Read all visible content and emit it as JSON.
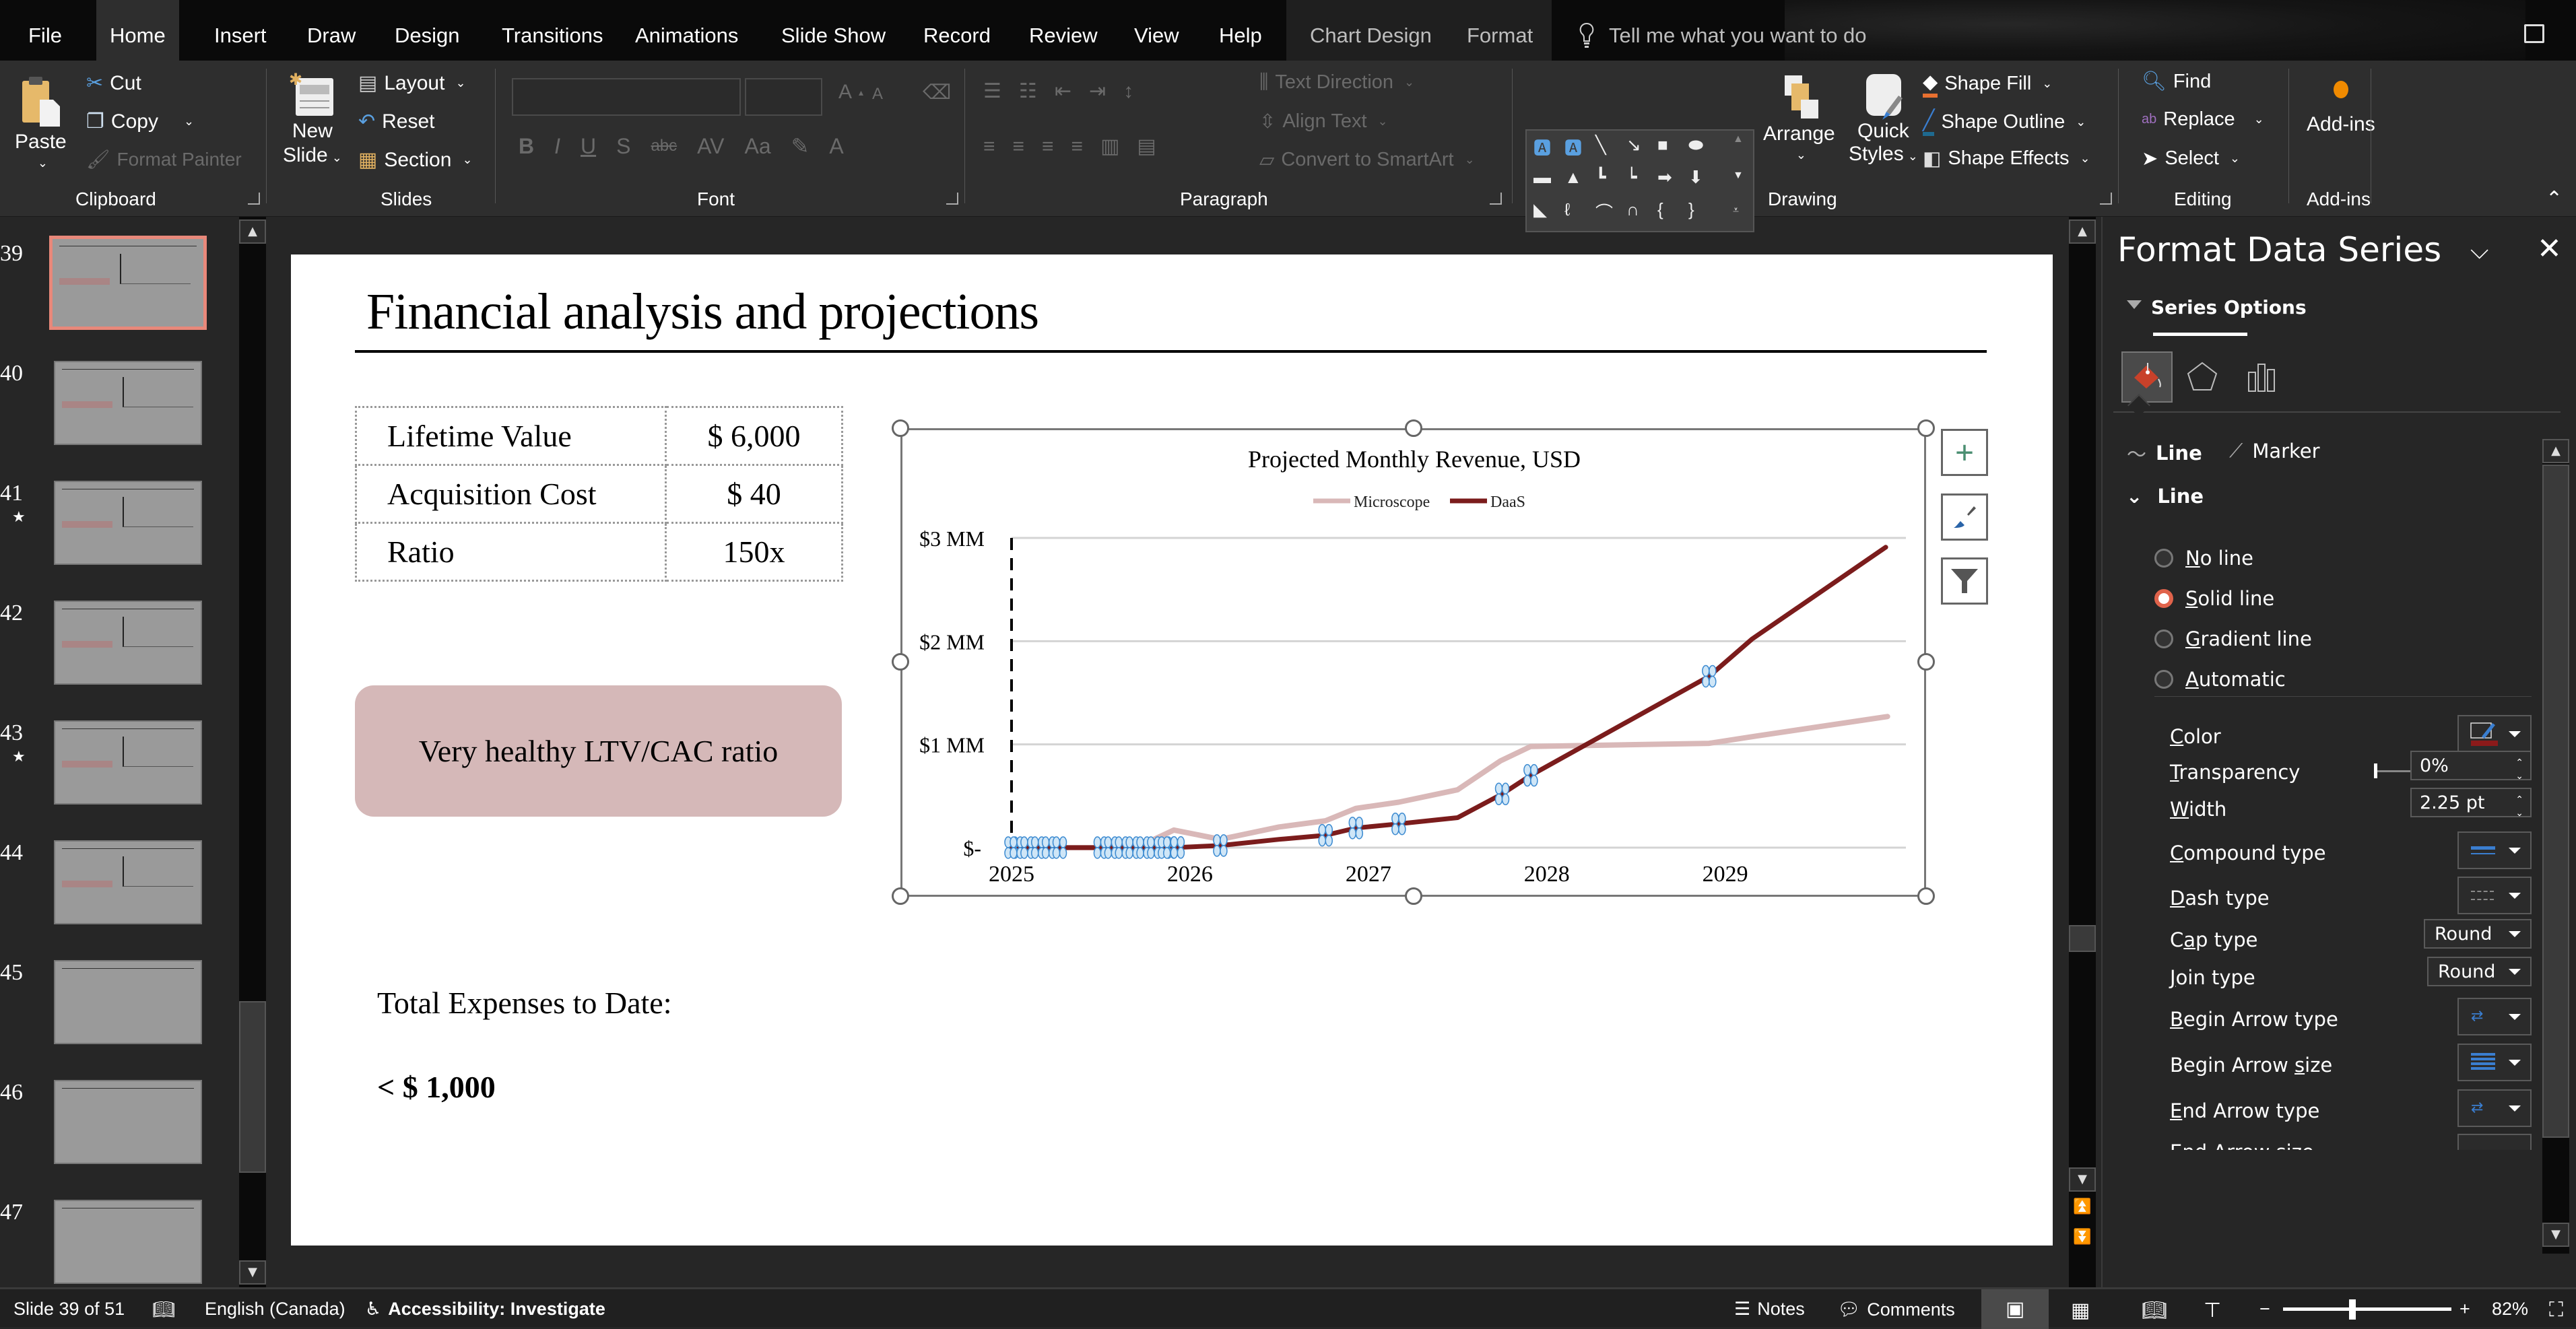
{
  "tabs": [
    {
      "label": "File"
    },
    {
      "label": "Home"
    },
    {
      "label": "Insert"
    },
    {
      "label": "Draw"
    },
    {
      "label": "Design"
    },
    {
      "label": "Transitions"
    },
    {
      "label": "Animations"
    },
    {
      "label": "Slide Show"
    },
    {
      "label": "Record"
    },
    {
      "label": "Review"
    },
    {
      "label": "View"
    },
    {
      "label": "Help"
    },
    {
      "label": "Chart Design"
    },
    {
      "label": "Format"
    }
  ],
  "active_tab": "Home",
  "tell_me_placeholder": "Tell me what you want to do",
  "ribbon": {
    "clipboard": {
      "label": "Clipboard",
      "paste": "Paste",
      "cut": "Cut",
      "copy": "Copy",
      "format_painter": "Format Painter"
    },
    "slides": {
      "label": "Slides",
      "new_slide_1": "New",
      "new_slide_2": "Slide",
      "layout": "Layout",
      "reset": "Reset",
      "section": "Section"
    },
    "font": {
      "label": "Font",
      "bold": "B",
      "italic": "I",
      "underline": "U",
      "shadow": "S",
      "strike": "abc",
      "spacing": "AV",
      "case": "Aa",
      "color": "A"
    },
    "paragraph": {
      "label": "Paragraph",
      "text_direction": "Text Direction",
      "align_text": "Align Text",
      "convert_smartart": "Convert to SmartArt"
    },
    "drawing": {
      "label": "Drawing",
      "arrange": "Arrange",
      "quick_styles_1": "Quick",
      "quick_styles_2": "Styles",
      "shape_fill": "Shape Fill",
      "shape_outline": "Shape Outline",
      "shape_effects": "Shape Effects"
    },
    "editing": {
      "label": "Editing",
      "find": "Find",
      "replace": "Replace",
      "select": "Select"
    },
    "addins": {
      "label": "Add-ins",
      "button": "Add-ins"
    }
  },
  "thumbnails": [
    {
      "num": "39",
      "star": false,
      "selected": true
    },
    {
      "num": "40",
      "star": false,
      "selected": false
    },
    {
      "num": "41",
      "star": true,
      "selected": false
    },
    {
      "num": "42",
      "star": false,
      "selected": false
    },
    {
      "num": "43",
      "star": true,
      "selected": false
    },
    {
      "num": "44",
      "star": false,
      "selected": false
    },
    {
      "num": "45",
      "star": false,
      "selected": false
    },
    {
      "num": "46",
      "star": false,
      "selected": false
    },
    {
      "num": "47",
      "star": false,
      "selected": false
    }
  ],
  "slide": {
    "title": "Financial analysis and projections",
    "kpis": [
      {
        "label": "Lifetime Value",
        "value": "$ 6,000"
      },
      {
        "label": "Acquisition Cost",
        "value": "$ 40"
      },
      {
        "label": "Ratio",
        "value": "150x"
      }
    ],
    "callout": "Very healthy LTV/CAC ratio",
    "expenses_label": "Total Expenses to Date:",
    "expenses_value": "< $ 1,000"
  },
  "chart_data": {
    "type": "line",
    "title": "Projected Monthly Revenue, USD",
    "xlabel": "",
    "ylabel": "",
    "xlim": [
      2025,
      2030
    ],
    "ylim": [
      0,
      3
    ],
    "x_ticks": [
      "2025",
      "2026",
      "2027",
      "2028",
      "2029"
    ],
    "y_ticks": [
      {
        "value": 0,
        "label": "$-"
      },
      {
        "value": 1,
        "label": "$1 MM"
      },
      {
        "value": 2,
        "label": "$2 MM"
      },
      {
        "value": 3,
        "label": "$3 MM"
      }
    ],
    "grid": true,
    "legend": "top-center",
    "annotations": [
      {
        "type": "dashed-vertical-line",
        "x": 2025
      }
    ],
    "series": [
      {
        "name": "Microscope",
        "color": "#d9b8b8",
        "points": [
          [
            2025.0,
            0
          ],
          [
            2025.7,
            0
          ],
          [
            2025.91,
            0.17
          ],
          [
            2026.17,
            0.08
          ],
          [
            2026.5,
            0.2
          ],
          [
            2026.76,
            0.26
          ],
          [
            2026.93,
            0.38
          ],
          [
            2027.17,
            0.44
          ],
          [
            2027.5,
            0.56
          ],
          [
            2027.74,
            0.84
          ],
          [
            2027.91,
            0.98
          ],
          [
            2028.91,
            1.01
          ],
          [
            2029.17,
            1.08
          ],
          [
            2029.91,
            1.27
          ]
        ]
      },
      {
        "name": "DaaS",
        "color": "#7b1c1c",
        "points": [
          [
            2025.0,
            0
          ],
          [
            2025.91,
            0
          ],
          [
            2026.17,
            0.02
          ],
          [
            2026.5,
            0.08
          ],
          [
            2026.76,
            0.12
          ],
          [
            2026.93,
            0.19
          ],
          [
            2027.17,
            0.23
          ],
          [
            2027.5,
            0.29
          ],
          [
            2027.75,
            0.52
          ],
          [
            2027.91,
            0.7
          ],
          [
            2028.91,
            1.66
          ],
          [
            2029.15,
            2.02
          ],
          [
            2029.9,
            2.91
          ]
        ],
        "selected_markers_x": [
          2025.0,
          2025.03,
          2025.09,
          2025.15,
          2025.21,
          2025.27,
          2025.5,
          2025.56,
          2025.62,
          2025.68,
          2025.74,
          2025.8,
          2025.86,
          2025.89,
          2025.93,
          2026.17,
          2026.76,
          2026.93,
          2027.17,
          2027.75,
          2027.91,
          2028.91
        ]
      }
    ]
  },
  "format_pane": {
    "title": "Format Data Series",
    "section_tab": "Series Options",
    "subtabs": {
      "line": "Line",
      "marker": "Marker"
    },
    "line_header": "Line",
    "line_options": [
      {
        "label": "No line",
        "accel": "N",
        "rest": "o line",
        "selected": false
      },
      {
        "label": "Solid line",
        "accel": "S",
        "rest": "olid line",
        "selected": true
      },
      {
        "label": "Gradient line",
        "accel": "G",
        "rest": "radient line",
        "selected": false
      },
      {
        "label": "Automatic",
        "accel": "A",
        "rest": "utomatic",
        "selected": false
      }
    ],
    "props": {
      "color": "Color",
      "color_value": "#8b1a1a",
      "transparency": "Transparency",
      "transparency_value": "0%",
      "width": "Width",
      "width_value": "2.25 pt",
      "compound": "Compound type",
      "dash": "Dash type",
      "cap": "Cap type",
      "cap_value": "Round",
      "join": "Join type",
      "join_value": "Round",
      "begin_arrow_type": "Begin Arrow type",
      "begin_arrow_size": "Begin Arrow size",
      "end_arrow_type": "End Arrow type",
      "end_arrow_size": "End Arrow size"
    }
  },
  "status": {
    "slide": "Slide 39 of 51",
    "language": "English (Canada)",
    "accessibility": "Accessibility: Investigate",
    "notes": "Notes",
    "comments": "Comments",
    "zoom": "82%",
    "zoom_fraction": 0.41
  }
}
